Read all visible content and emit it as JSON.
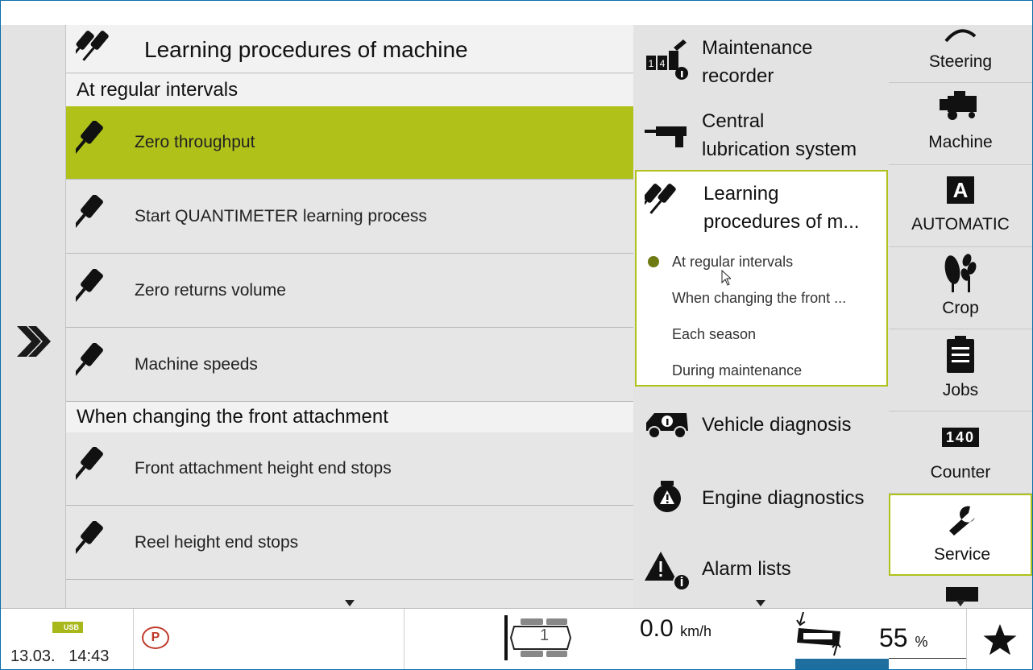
{
  "main": {
    "title": "Learning procedures of machine",
    "sections": [
      {
        "label": "At regular intervals"
      },
      {
        "label": "When changing the front attachment"
      }
    ],
    "rows": [
      {
        "label": "Zero throughput",
        "selected": true
      },
      {
        "label": "Start QUANTIMETER learning process"
      },
      {
        "label": "Zero returns volume"
      },
      {
        "label": "Machine speeds"
      },
      {
        "label": "Front attachment height end stops"
      },
      {
        "label": "Reel height end stops"
      }
    ]
  },
  "menu": {
    "items": [
      {
        "line1": "Maintenance",
        "line2": "recorder",
        "icon": "maintenance-recorder-icon"
      },
      {
        "line1": "Central",
        "line2": "lubrication system",
        "icon": "grease-gun-icon"
      },
      {
        "line1": "Learning",
        "line2": "procedures of m...",
        "icon": "learning-tools-icon"
      },
      {
        "line1": "Vehicle diagnosis",
        "icon": "vehicle-diagnosis-icon"
      },
      {
        "line1": "Engine diagnostics",
        "icon": "engine-diagnostics-icon"
      },
      {
        "line1": "Alarm lists",
        "icon": "alarm-list-icon"
      }
    ],
    "subitems": [
      {
        "label": "At regular intervals",
        "active": true
      },
      {
        "label": "When changing the front ..."
      },
      {
        "label": "Each season"
      },
      {
        "label": "During maintenance"
      }
    ]
  },
  "rail": {
    "items": [
      {
        "label": "Steering",
        "icon": "steering-icon"
      },
      {
        "label": "Machine",
        "icon": "combine-harvester-icon"
      },
      {
        "label": "AUTOMATIC",
        "icon": "automatic-a-icon",
        "glyph": "A"
      },
      {
        "label": "Crop",
        "icon": "crop-icon"
      },
      {
        "label": "Jobs",
        "icon": "clipboard-icon"
      },
      {
        "label": "Counter",
        "icon": "counter-icon",
        "digits": "140"
      },
      {
        "label": "Service",
        "icon": "wrench-icon",
        "selected": true
      }
    ]
  },
  "status": {
    "usb": "USB",
    "date": "13.03.",
    "time": "14:43",
    "parking": "P",
    "gear": "1",
    "speed": "0.0",
    "speed_unit": "km/h",
    "percent": "55",
    "percent_unit": "%",
    "percent_value": 0.55
  },
  "colors": {
    "accent": "#b0c21a",
    "bar": "#1f6ea0",
    "parking": "#c0392b"
  }
}
